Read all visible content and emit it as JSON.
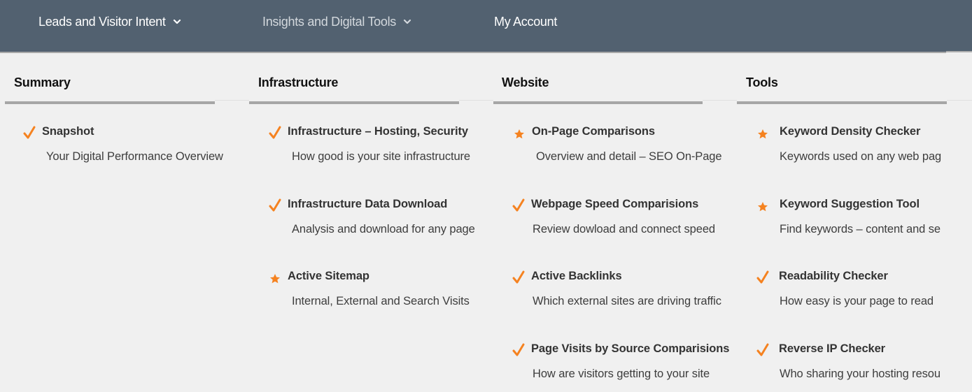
{
  "nav": {
    "items": [
      {
        "label": "Leads and Visitor Intent",
        "has_dropdown": true,
        "active": true
      },
      {
        "label": "Insights and Digital Tools",
        "has_dropdown": true,
        "active": false
      },
      {
        "label": "My Account",
        "has_dropdown": false,
        "active": true
      }
    ]
  },
  "theme": {
    "header_bg": "#526170",
    "panel_bg": "#f0f0f0",
    "accent": "#f58220",
    "rule": "#a6a6a6"
  },
  "columns": [
    {
      "title": "Summary",
      "items": [
        {
          "icon": "check-icon",
          "title": "Snapshot",
          "subtitle": "Your Digital Performance Overview"
        }
      ]
    },
    {
      "title": "Infrastructure",
      "items": [
        {
          "icon": "check-icon",
          "title": "Infrastructure – Hosting, Security",
          "subtitle": "How good is your site infrastructure"
        },
        {
          "icon": "check-icon",
          "title": "Infrastructure Data Download",
          "subtitle": "Analysis and download for any page"
        },
        {
          "icon": "star-icon",
          "title": "Active Sitemap",
          "subtitle": "Internal, External and Search Visits"
        }
      ]
    },
    {
      "title": "Website",
      "items": [
        {
          "icon": "star-icon",
          "title": "On-Page Comparisons",
          "subtitle": "Overview and detail – SEO On-Page"
        },
        {
          "icon": "check-icon",
          "title": "Webpage Speed Comparisions",
          "subtitle": "Review dowload and connect speed"
        },
        {
          "icon": "check-icon",
          "title": "Active Backlinks",
          "subtitle": "Which external sites are driving traffic"
        },
        {
          "icon": "check-icon",
          "title": "Page Visits by Source Comparisions",
          "subtitle": "How are visitors getting to your site"
        }
      ]
    },
    {
      "title": "Tools",
      "items": [
        {
          "icon": "star-icon",
          "title": "Keyword Density Checker",
          "subtitle": "Keywords used on any web pag"
        },
        {
          "icon": "star-icon",
          "title": "Keyword Suggestion Tool",
          "subtitle": "Find keywords – content and se"
        },
        {
          "icon": "check-icon",
          "title": "Readability Checker",
          "subtitle": "How easy is your page to read"
        },
        {
          "icon": "check-icon",
          "title": "Reverse IP Checker",
          "subtitle": "Who sharing your hosting resou"
        }
      ]
    }
  ]
}
